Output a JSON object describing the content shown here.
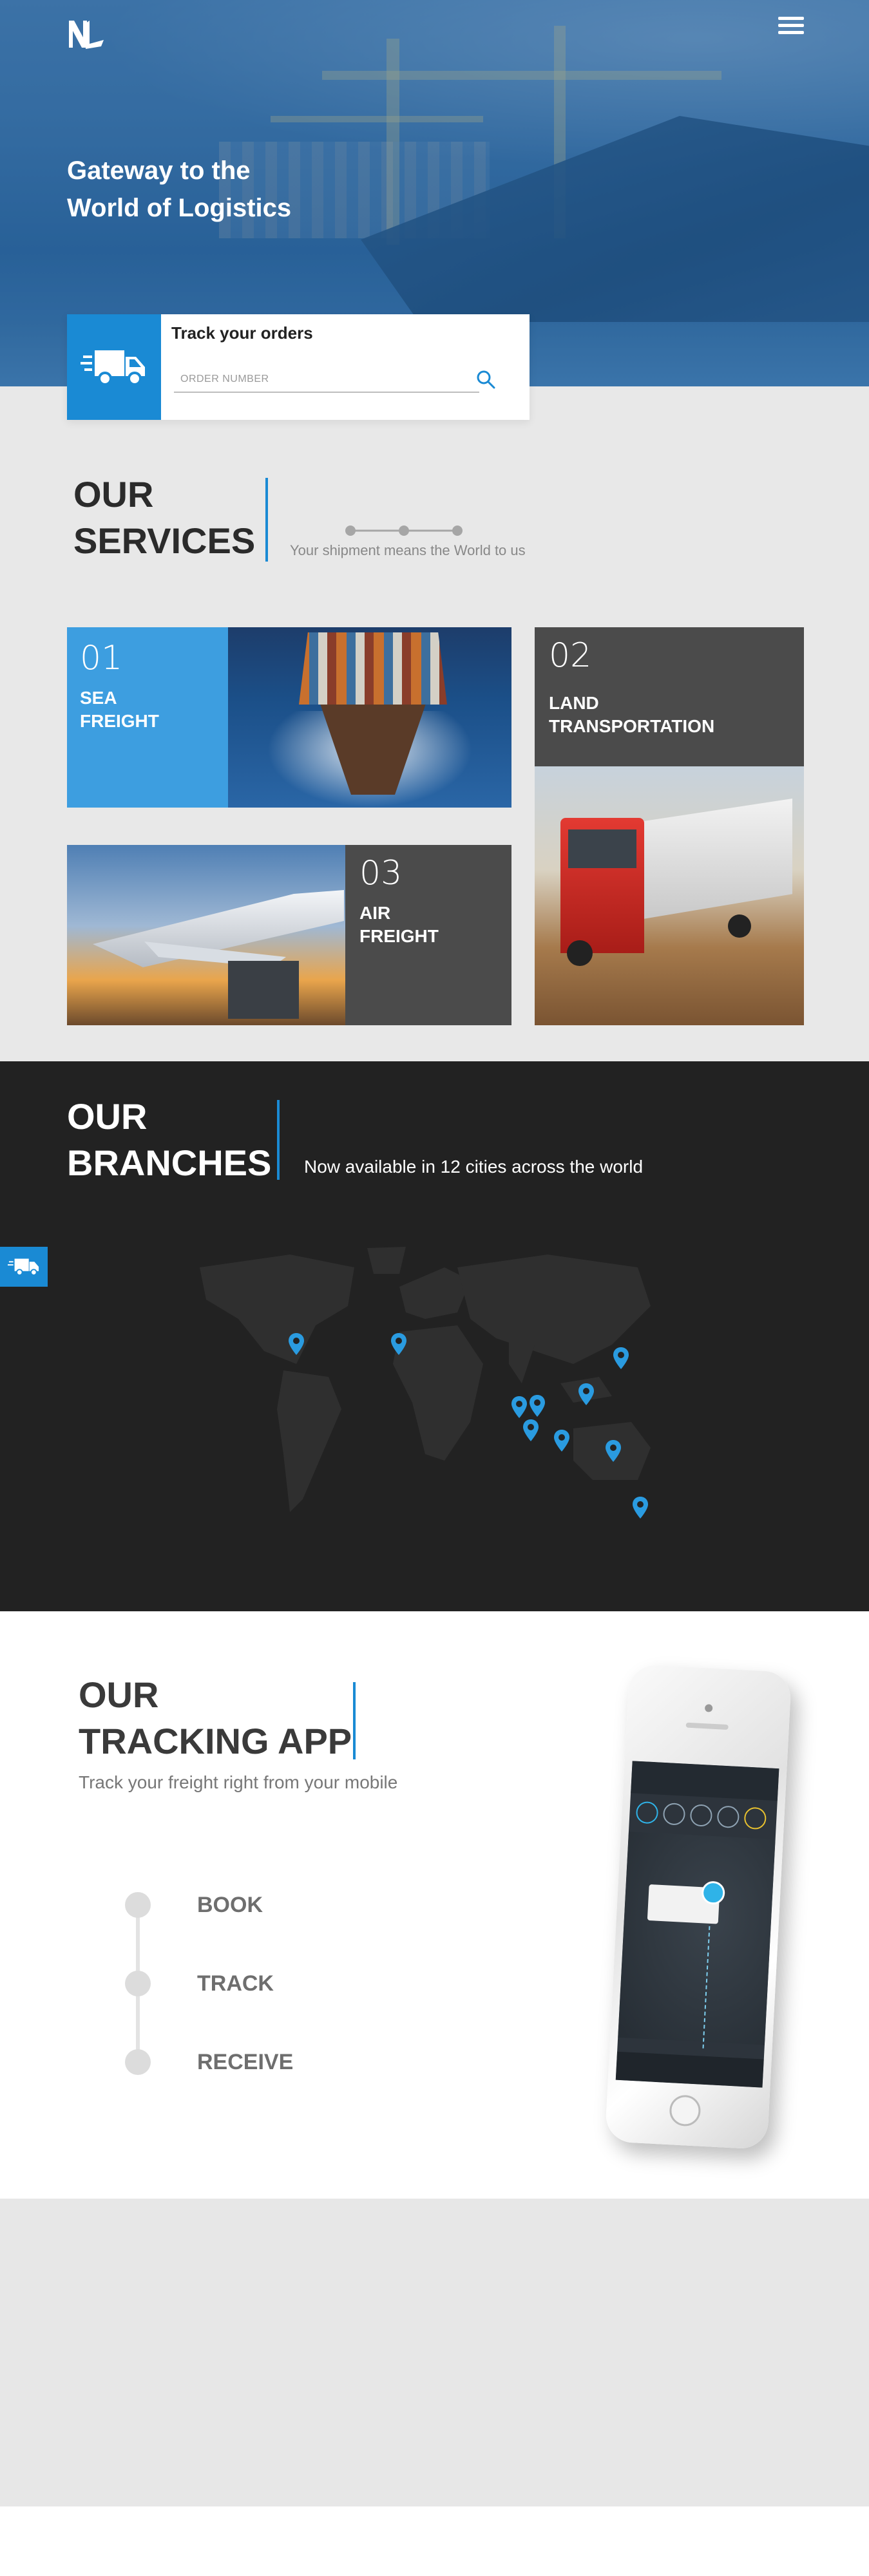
{
  "header": {
    "logo_text": "NL",
    "menu_icon": "hamburger-menu-icon"
  },
  "hero": {
    "title_line1": "Gateway to the",
    "title_line2": "World of Logistics"
  },
  "tracking": {
    "title": "Track your orders",
    "placeholder": "ORDER NUMBER",
    "value": "",
    "icon": "delivery-truck-icon",
    "search_icon": "search-icon"
  },
  "services": {
    "heading_line1": "OUR",
    "heading_line2": "SERVICES",
    "subtitle": "Your shipment means the World to us",
    "cards": [
      {
        "number": "01",
        "label_line1": "SEA",
        "label_line2": "FREIGHT"
      },
      {
        "number": "02",
        "label_line1": "LAND",
        "label_line2": "TRANSPORTATION"
      },
      {
        "number": "03",
        "label_line1": "AIR",
        "label_line2": "FREIGHT"
      }
    ]
  },
  "branches": {
    "heading_line1": "OUR",
    "heading_line2": "BRANCHES",
    "subtitle": "Now available in 12 cities across the world",
    "pin_icon": "map-pin-icon",
    "pin_count": 12
  },
  "app": {
    "heading_line1": "OUR",
    "heading_line2": "TRACKING APP",
    "subtitle": "Track your freight right from your mobile",
    "steps": [
      "BOOK",
      "TRACK",
      "RECEIVE"
    ]
  },
  "colors": {
    "accent": "#1a8ad4",
    "dark": "#222222",
    "card_gray": "#4a4a4a",
    "light_bg": "#e8e8e8"
  }
}
